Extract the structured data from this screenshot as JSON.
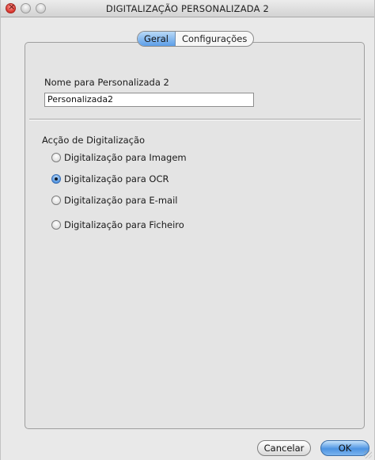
{
  "window": {
    "title": "DIGITALIZAÇÃO PERSONALIZADA 2"
  },
  "tabs": [
    {
      "label": "Geral",
      "selected": true
    },
    {
      "label": "Configurações",
      "selected": false
    }
  ],
  "name_section": {
    "label": "Nome para Personalizada 2",
    "value": "Personalizada2"
  },
  "scan_action": {
    "heading": "Acção de Digitalização",
    "options": [
      {
        "label": "Digitalização para Imagem",
        "checked": false
      },
      {
        "label": "Digitalização para OCR",
        "checked": true
      },
      {
        "label": "Digitalização para E-mail",
        "checked": false
      },
      {
        "label": "Digitalização para Ficheiro",
        "checked": false
      }
    ]
  },
  "buttons": {
    "cancel": "Cancelar",
    "ok": "OK"
  },
  "colors": {
    "accent": "#5c9ee8",
    "close_button": "#d9342c"
  }
}
